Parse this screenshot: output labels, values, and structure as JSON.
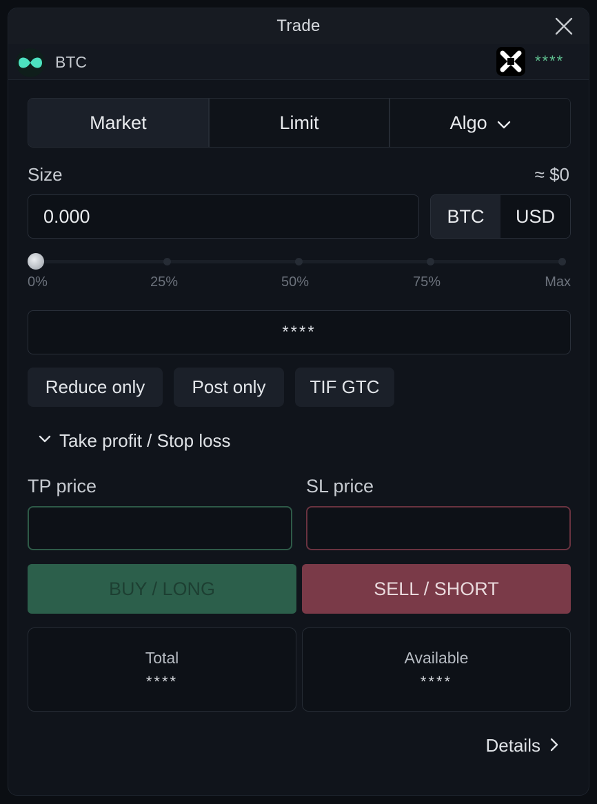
{
  "window": {
    "title": "Trade"
  },
  "asset": {
    "symbol": "BTC",
    "account_mask": "****"
  },
  "order_tabs": [
    {
      "label": "Market",
      "active": true
    },
    {
      "label": "Limit",
      "active": false
    },
    {
      "label": "Algo",
      "active": false,
      "has_dropdown": true
    }
  ],
  "size": {
    "label": "Size",
    "usd_estimate": "≈ $0",
    "value": "0.000",
    "units": [
      {
        "label": "BTC",
        "active": true
      },
      {
        "label": "USD",
        "active": false
      }
    ]
  },
  "slider": {
    "value_percent": 0,
    "labels": [
      "0%",
      "25%",
      "50%",
      "75%",
      "Max"
    ]
  },
  "masked_field": "****",
  "options": [
    "Reduce only",
    "Post only",
    "TIF GTC"
  ],
  "tpsl": {
    "toggle_label": "Take profit / Stop loss",
    "expanded": true,
    "tp_label": "TP price",
    "sl_label": "SL price",
    "tp_value": "",
    "sl_value": ""
  },
  "actions": {
    "buy_label": "BUY / LONG",
    "sell_label": "SELL / SHORT"
  },
  "stats": {
    "total_label": "Total",
    "total_value": "****",
    "available_label": "Available",
    "available_value": "****"
  },
  "details_label": "Details",
  "colors": {
    "accent_green": "#2c5f4b",
    "accent_red": "#7a3a48",
    "mask_green": "#5fbf8f",
    "logo_teal": "#4de2c0"
  },
  "icons": {
    "close": "close-icon",
    "asset_logo": "hyperliquid-logo-icon",
    "account_logo": "wallet-logo-icon",
    "dropdown": "chevron-down-icon",
    "details": "chevron-right-icon"
  }
}
